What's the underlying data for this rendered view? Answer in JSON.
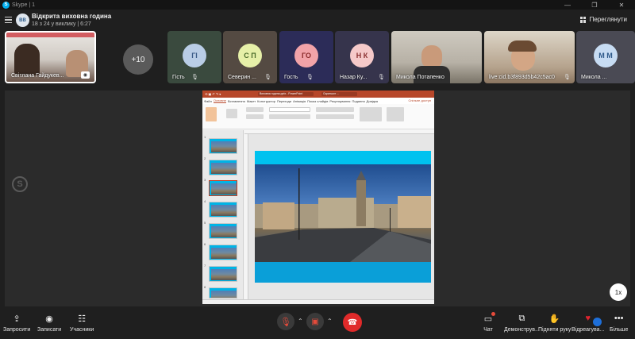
{
  "window": {
    "title": "Skype | 1",
    "app_icon": "S",
    "minimize": "—",
    "restore": "❐",
    "close": "✕"
  },
  "header": {
    "group_avatar": "ВВ",
    "call_title": "Відкрита виховна година",
    "call_subtitle": "18 з 24 у виклику | 6:27",
    "view_label": "Переглянути"
  },
  "participants": [
    {
      "name": "Світлана Гайдукев...",
      "type": "video",
      "self": true
    },
    {
      "name": "Гість",
      "initials": "ГІ",
      "color": "#b9cde6",
      "bg": "#3a4a3e"
    },
    {
      "name": "Северин ...",
      "initials": "С П",
      "color": "#e6f0a8",
      "bg": "#544a42"
    },
    {
      "name": "Гость",
      "initials": "ГО",
      "color": "#f2a3a8",
      "bg": "#2c2c58"
    },
    {
      "name": "Назар Ку...",
      "initials": "Н К",
      "color": "#f5c9c9",
      "bg": "#36344c"
    },
    {
      "name": "Микола Потапенко",
      "type": "video"
    },
    {
      "name": "live:cid.b3f893d5b42c5ac0",
      "type": "video"
    },
    {
      "name": "Микола ...",
      "initials": "М М",
      "color": "#c7dcf3",
      "bg": "#4a4a54"
    }
  ],
  "more_count": "+10",
  "zoom_level": "1x",
  "shared_screen": {
    "ppt_tab": "Виховна година.pptx - PowerPoint",
    "ppt_tab2": "Скриншот ...",
    "menu": [
      "Файл",
      "Основне",
      "Вставлення",
      "Макет",
      "Конструктор",
      "Переходи",
      "Анімація",
      "Показ слайдів",
      "Рецензування",
      "Подання",
      "Довідка"
    ],
    "share_label": "Спільне доступ",
    "slide_numbers": [
      "1",
      "2",
      "3",
      "4",
      "5",
      "6",
      "7",
      "8",
      "9"
    ]
  },
  "controls": {
    "invite": "Запросити",
    "record": "Записати",
    "participants": "Учасники",
    "chat": "Чат",
    "share": "Демонструв...",
    "raise_hand": "Підняти руку",
    "react": "Відреагува...",
    "more": "Більше"
  }
}
